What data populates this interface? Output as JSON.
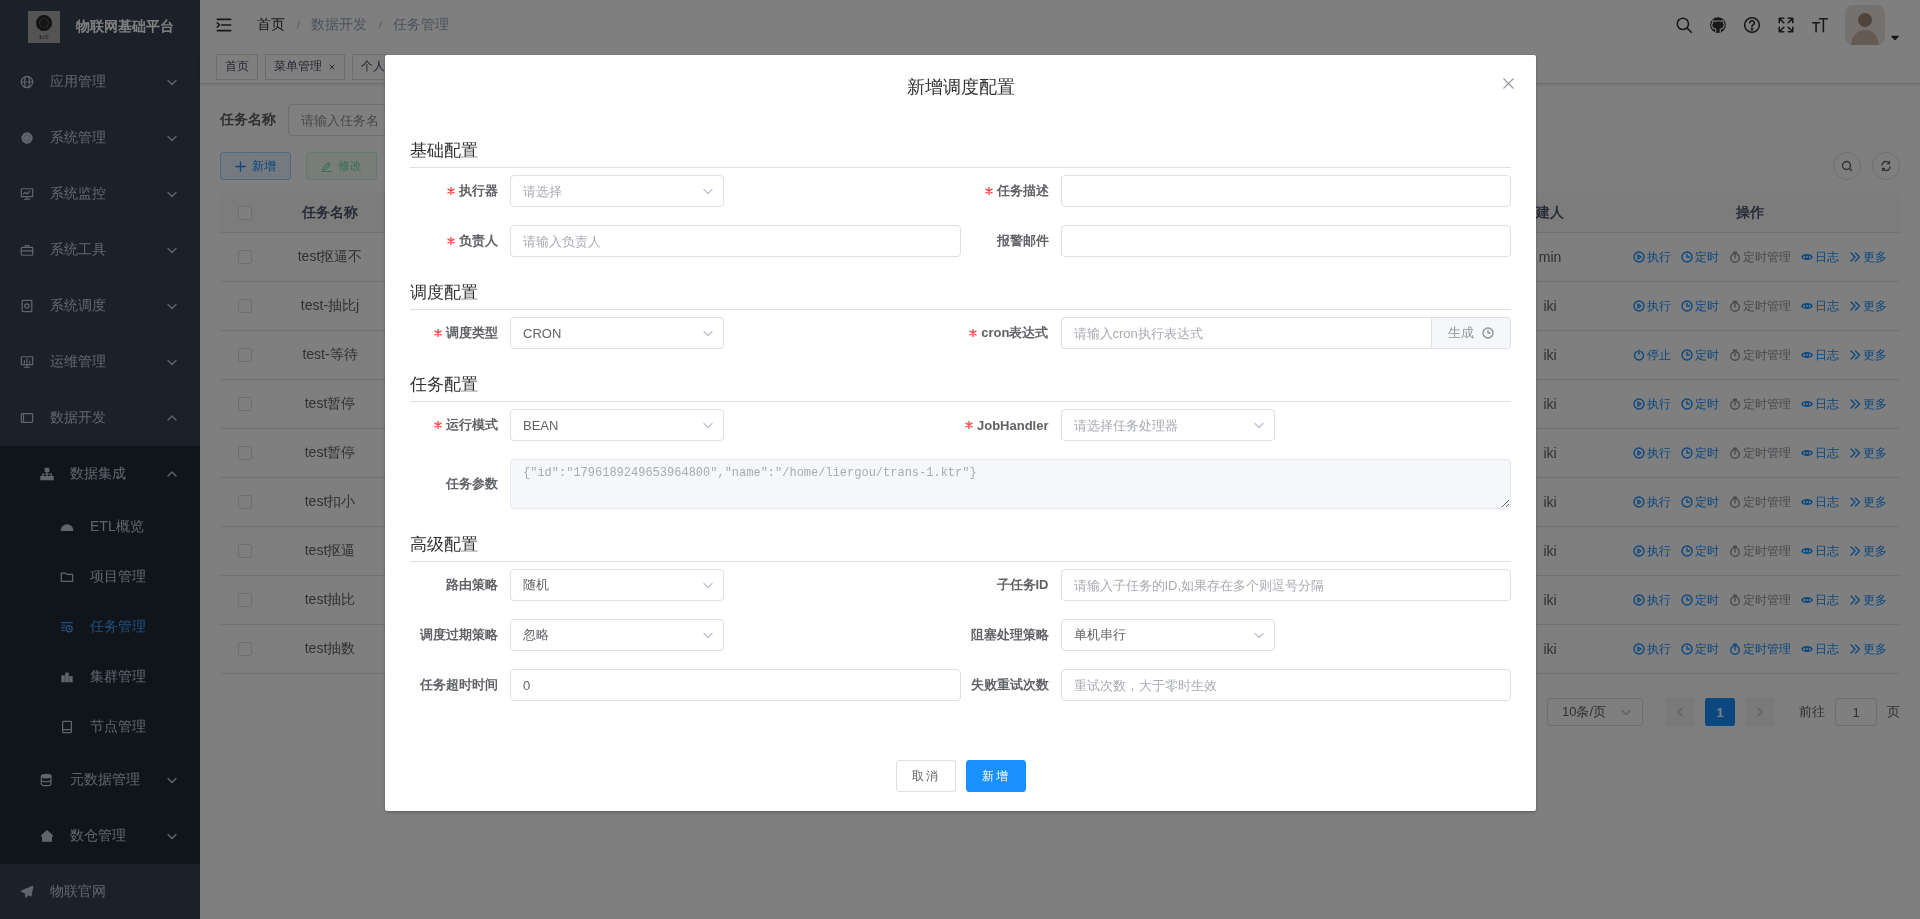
{
  "sidebar": {
    "logo_mark": "IoT",
    "title": "物联网基础平台",
    "items": [
      {
        "label": "应用管理",
        "kind": "submenu",
        "expanded": false,
        "selected": false
      },
      {
        "label": "系统管理",
        "kind": "submenu",
        "expanded": false,
        "selected": false
      },
      {
        "label": "系统监控",
        "kind": "submenu",
        "expanded": false,
        "selected": false
      },
      {
        "label": "系统工具",
        "kind": "submenu",
        "expanded": false,
        "selected": false
      },
      {
        "label": "系统调度",
        "kind": "submenu",
        "expanded": false,
        "selected": false
      },
      {
        "label": "运维管理",
        "kind": "submenu",
        "expanded": false,
        "selected": false
      },
      {
        "label": "数据开发",
        "kind": "submenu",
        "expanded": true,
        "selected": false,
        "children": [
          {
            "label": "数据集成",
            "kind": "submenu",
            "expanded": true,
            "selected": false,
            "children": [
              {
                "label": "ETL概览",
                "kind": "link",
                "selected": false
              },
              {
                "label": "项目管理",
                "kind": "link",
                "selected": false
              },
              {
                "label": "任务管理",
                "kind": "link",
                "selected": true
              },
              {
                "label": "集群管理",
                "kind": "link",
                "selected": false
              },
              {
                "label": "节点管理",
                "kind": "link",
                "selected": false
              }
            ]
          },
          {
            "label": "元数据管理",
            "kind": "submenu",
            "expanded": false,
            "selected": false
          },
          {
            "label": "数仓管理",
            "kind": "submenu",
            "expanded": false,
            "selected": false
          }
        ]
      },
      {
        "label": "物联官网",
        "kind": "link",
        "selected": false
      }
    ]
  },
  "header": {
    "breadcrumb": [
      "首页",
      "数据开发",
      "任务管理"
    ]
  },
  "tags": [
    {
      "label": "首页",
      "closable": false
    },
    {
      "label": "菜单管理",
      "closable": true
    },
    {
      "label": "个人",
      "closable": false
    }
  ],
  "search": {
    "label": "任务名称",
    "placeholder": "请输入任务名"
  },
  "toolbar": [
    {
      "label": "新增",
      "kind": "add"
    },
    {
      "label": "修改",
      "kind": "edit"
    }
  ],
  "table": {
    "columns": [
      "任务名称",
      "建人",
      "操作"
    ],
    "header_checked": false,
    "rows": [
      {
        "checked": false,
        "name": "test抠逼不",
        "creator": "min",
        "actions": [
          {
            "kind": "run",
            "label": "执行",
            "disabled": false
          },
          {
            "kind": "timer",
            "label": "定时",
            "disabled": false
          },
          {
            "kind": "manage",
            "label": "定时管理",
            "disabled": true
          },
          {
            "kind": "log",
            "label": "日志",
            "disabled": false
          },
          {
            "kind": "more",
            "label": "更多",
            "disabled": false
          }
        ]
      },
      {
        "checked": false,
        "name": "test-抽比j",
        "creator": "iki",
        "actions": [
          {
            "kind": "run",
            "label": "执行",
            "disabled": false
          },
          {
            "kind": "timer",
            "label": "定时",
            "disabled": false
          },
          {
            "kind": "manage",
            "label": "定时管理",
            "disabled": true
          },
          {
            "kind": "log",
            "label": "日志",
            "disabled": false
          },
          {
            "kind": "more",
            "label": "更多",
            "disabled": false
          }
        ]
      },
      {
        "checked": false,
        "name": "test-等待",
        "creator": "iki",
        "actions": [
          {
            "kind": "stop",
            "label": "停止",
            "disabled": false
          },
          {
            "kind": "timer",
            "label": "定时",
            "disabled": false
          },
          {
            "kind": "manage",
            "label": "定时管理",
            "disabled": true
          },
          {
            "kind": "log",
            "label": "日志",
            "disabled": false
          },
          {
            "kind": "more",
            "label": "更多",
            "disabled": false
          }
        ]
      },
      {
        "checked": false,
        "name": "test暂停",
        "creator": "iki",
        "actions": [
          {
            "kind": "run",
            "label": "执行",
            "disabled": false
          },
          {
            "kind": "timer",
            "label": "定时",
            "disabled": false
          },
          {
            "kind": "manage",
            "label": "定时管理",
            "disabled": true
          },
          {
            "kind": "log",
            "label": "日志",
            "disabled": false
          },
          {
            "kind": "more",
            "label": "更多",
            "disabled": false
          }
        ]
      },
      {
        "checked": false,
        "name": "test暂停",
        "creator": "iki",
        "actions": [
          {
            "kind": "run",
            "label": "执行",
            "disabled": false
          },
          {
            "kind": "timer",
            "label": "定时",
            "disabled": false
          },
          {
            "kind": "manage",
            "label": "定时管理",
            "disabled": true
          },
          {
            "kind": "log",
            "label": "日志",
            "disabled": false
          },
          {
            "kind": "more",
            "label": "更多",
            "disabled": false
          }
        ]
      },
      {
        "checked": false,
        "name": "test扣小",
        "creator": "iki",
        "actions": [
          {
            "kind": "run",
            "label": "执行",
            "disabled": false
          },
          {
            "kind": "timer",
            "label": "定时",
            "disabled": false
          },
          {
            "kind": "manage",
            "label": "定时管理",
            "disabled": true
          },
          {
            "kind": "log",
            "label": "日志",
            "disabled": false
          },
          {
            "kind": "more",
            "label": "更多",
            "disabled": false
          }
        ]
      },
      {
        "checked": false,
        "name": "test抠逼",
        "creator": "iki",
        "actions": [
          {
            "kind": "run",
            "label": "执行",
            "disabled": false
          },
          {
            "kind": "timer",
            "label": "定时",
            "disabled": false
          },
          {
            "kind": "manage",
            "label": "定时管理",
            "disabled": true
          },
          {
            "kind": "log",
            "label": "日志",
            "disabled": false
          },
          {
            "kind": "more",
            "label": "更多",
            "disabled": false
          }
        ]
      },
      {
        "checked": false,
        "name": "test抽比",
        "creator": "iki",
        "actions": [
          {
            "kind": "run",
            "label": "执行",
            "disabled": false
          },
          {
            "kind": "timer",
            "label": "定时",
            "disabled": false
          },
          {
            "kind": "manage",
            "label": "定时管理",
            "disabled": true
          },
          {
            "kind": "log",
            "label": "日志",
            "disabled": false
          },
          {
            "kind": "more",
            "label": "更多",
            "disabled": false
          }
        ]
      },
      {
        "checked": false,
        "name": "test抽数",
        "creator": "iki",
        "actions": [
          {
            "kind": "run",
            "label": "执行",
            "disabled": false
          },
          {
            "kind": "timer",
            "label": "定时",
            "disabled": false
          },
          {
            "kind": "manage",
            "label": "定时管理",
            "disabled": false
          },
          {
            "kind": "log",
            "label": "日志",
            "disabled": false
          },
          {
            "kind": "more",
            "label": "更多",
            "disabled": false
          }
        ]
      }
    ]
  },
  "pagination": {
    "size": "10条/页",
    "prev_disabled": true,
    "pages": [
      {
        "label": "1",
        "selected": true
      }
    ],
    "next_disabled": true,
    "goto_label": "前往",
    "goto_value": "1",
    "unit": "页"
  },
  "dialog": {
    "title": "新增调度配置",
    "sections": [
      {
        "title": "基础配置",
        "fields": [
          {
            "label": "执行器",
            "required": true,
            "kind": "select",
            "placeholder": "请选择"
          },
          {
            "label": "任务描述",
            "required": true,
            "kind": "input"
          },
          {
            "label": "负责人",
            "required": true,
            "kind": "input",
            "placeholder": "请输入负责人"
          },
          {
            "label": "报警邮件",
            "required": false,
            "kind": "input"
          }
        ]
      },
      {
        "title": "调度配置",
        "fields": [
          {
            "label": "调度类型",
            "required": true,
            "kind": "select",
            "value": "CRON"
          },
          {
            "label": "cron表达式",
            "required": true,
            "kind": "input_button",
            "placeholder": "请输入cron执行表达式",
            "button": "生成"
          }
        ]
      },
      {
        "title": "任务配置",
        "fields": [
          {
            "label": "运行模式",
            "required": true,
            "kind": "select",
            "value": "BEAN"
          },
          {
            "label": "JobHandler",
            "required": true,
            "kind": "select",
            "placeholder": "请选择任务处理器"
          },
          {
            "label": "任务参数",
            "required": false,
            "kind": "textarea",
            "disabled": true,
            "value": "{\"id\":\"1796189249653964800\",\"name\":\"/home/liergou/trans-1.ktr\"}"
          }
        ]
      },
      {
        "title": "高级配置",
        "fields": [
          {
            "label": "路由策略",
            "required": false,
            "kind": "select",
            "value": "随机"
          },
          {
            "label": "子任务ID",
            "required": false,
            "kind": "input",
            "placeholder": "请输入子任务的ID,如果存在多个则逗号分隔"
          },
          {
            "label": "调度过期策略",
            "required": false,
            "kind": "select",
            "value": "忽略"
          },
          {
            "label": "阻塞处理策略",
            "required": false,
            "kind": "select",
            "value": "单机串行"
          },
          {
            "label": "任务超时时间",
            "required": false,
            "kind": "input",
            "value": "0"
          },
          {
            "label": "失败重试次数",
            "required": false,
            "kind": "input",
            "placeholder": "重试次数，大于零时生效"
          }
        ]
      }
    ],
    "buttons": [
      {
        "label": "取消",
        "kind": "default"
      },
      {
        "label": "新增",
        "kind": "primary"
      }
    ]
  }
}
